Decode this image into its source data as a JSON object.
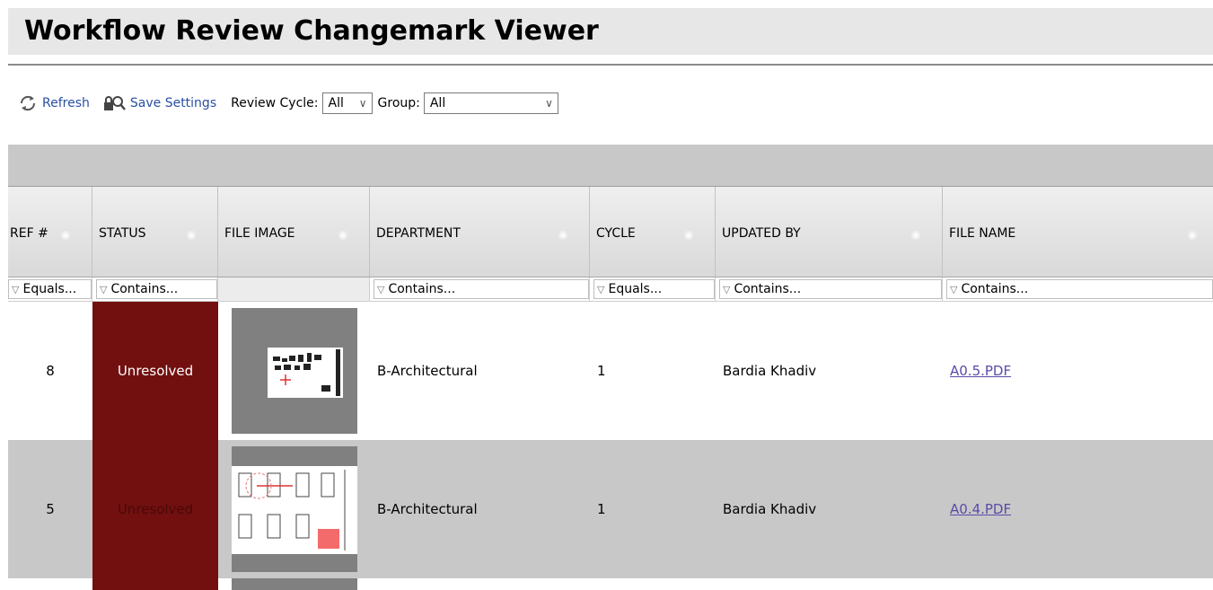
{
  "title": "Workflow Review Changemark Viewer",
  "toolbar": {
    "refresh_label": "Refresh",
    "save_label": "Save Settings",
    "review_cycle_label": "Review Cycle:",
    "review_cycle_value": "All",
    "group_label": "Group:",
    "group_value": "All"
  },
  "columns": [
    {
      "label": "REF #",
      "filter": "Equals..."
    },
    {
      "label": "STATUS",
      "filter": "Contains..."
    },
    {
      "label": "FILE IMAGE",
      "filter": ""
    },
    {
      "label": "DEPARTMENT",
      "filter": "Contains..."
    },
    {
      "label": "CYCLE",
      "filter": "Equals..."
    },
    {
      "label": "UPDATED BY",
      "filter": "Contains..."
    },
    {
      "label": "FILE NAME",
      "filter": "Contains..."
    }
  ],
  "rows": [
    {
      "ref": "8",
      "status": "Unresolved",
      "department": "B-Architectural",
      "cycle": "1",
      "updated_by": "Bardia Khadiv",
      "file_name": "A0.5.PDF"
    },
    {
      "ref": "5",
      "status": "Unresolved",
      "department": "B-Architectural",
      "cycle": "1",
      "updated_by": "Bardia Khadiv",
      "file_name": "A0.4.PDF"
    }
  ],
  "colors": {
    "status_unresolved": "#721010",
    "link": "#5b4ba8",
    "alt_row": "#c8c8c8"
  }
}
